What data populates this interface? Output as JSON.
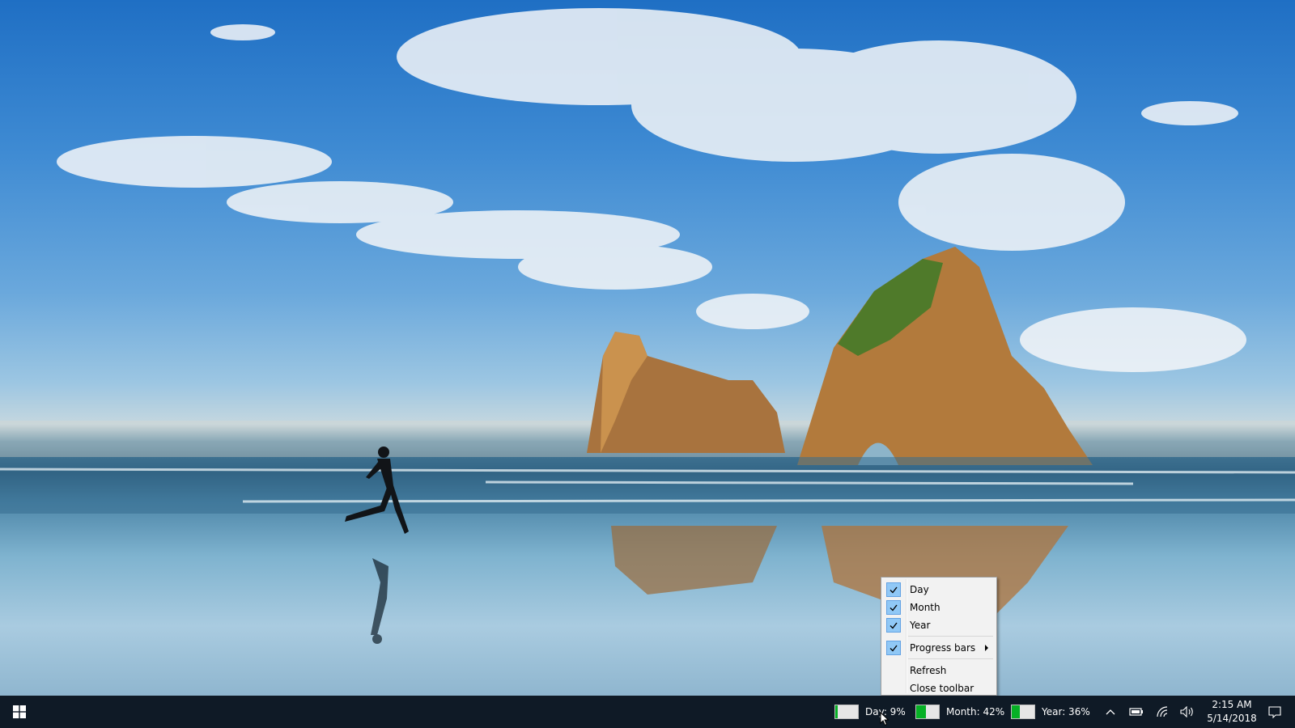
{
  "taskbar": {
    "start_icon": "windows-logo-icon",
    "meters": [
      {
        "label": "Day: 9%",
        "progress": 0.09
      },
      {
        "label": "Month: 42%",
        "progress": 0.42
      },
      {
        "label": "Year: 36%",
        "progress": 0.36
      }
    ],
    "tray_icons": [
      "chevron-up-icon",
      "battery-icon",
      "wifi-icon",
      "volume-icon"
    ],
    "clock": {
      "time": "2:15 AM",
      "date": "5/14/2018"
    },
    "notification_icon": "action-center-icon"
  },
  "context_menu": {
    "items": [
      {
        "label": "Day",
        "checked": true
      },
      {
        "label": "Month",
        "checked": true
      },
      {
        "label": "Year",
        "checked": true
      },
      {
        "label": "Progress bars",
        "checked": true,
        "submenu": true
      },
      {
        "label": "Refresh",
        "checked": false
      },
      {
        "label": "Close toolbar",
        "checked": false
      }
    ]
  },
  "colors": {
    "taskbar_bg": "#0f1a26",
    "meter_fill": "#06b025",
    "menu_bg": "#f2f2f2",
    "check_bg": "#90c8f6"
  }
}
